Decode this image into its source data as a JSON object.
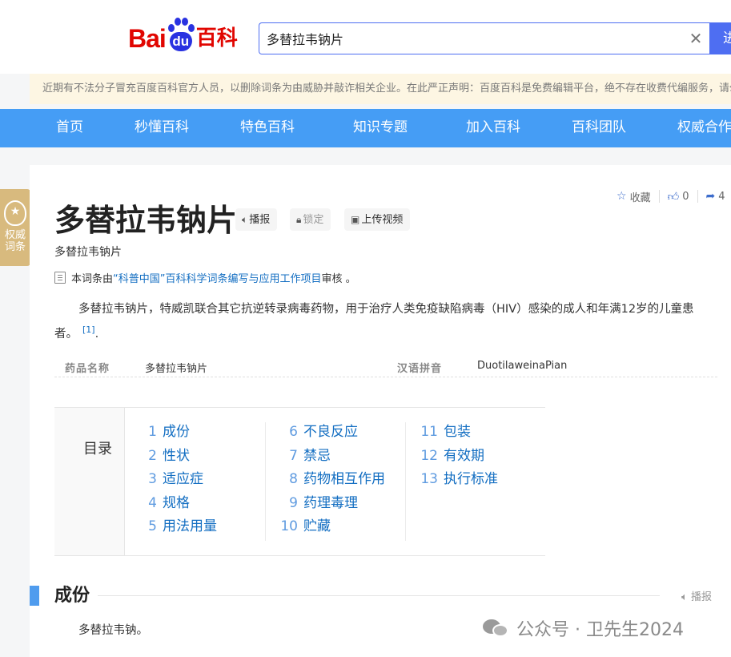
{
  "header": {
    "logo_bai": "Bai",
    "logo_du": "du",
    "logo_baike": "百科",
    "search_value": "多替拉韦钠片",
    "clear_glyph": "✕",
    "search_button": "进"
  },
  "notice": "近期有不法分子冒充百度百科官方人员，以删除词条为由威胁并敲诈相关企业。在此严正声明：百度百科是免费编辑平台，绝不存在收费代编服务，请勿上当受骗！",
  "nav": [
    "首页",
    "秒懂百科",
    "特色百科",
    "知识专题",
    "加入百科",
    "百科团队",
    "权威合作"
  ],
  "side_badge": {
    "line1": "权威",
    "line2": "词条"
  },
  "top_actions": {
    "collect": "收藏",
    "like_count": "0",
    "share_count": "4"
  },
  "title": "多替拉韦钠片",
  "title_buttons": {
    "play": "播报",
    "lock": "锁定",
    "upload_video": "上传视频"
  },
  "subtitle": "多替拉韦钠片",
  "review": {
    "prefix": "本词条由",
    "link": "“科普中国”百科科学词条编写与应用工作项目",
    "suffix": " 审核 。"
  },
  "summary": {
    "text": "多替拉韦钠片，特威凯联合其它抗逆转录病毒药物，用于治疗人类免疫缺陷病毒（HIV）感染的成人和年满12岁的儿童患者。",
    "ref": "[1]"
  },
  "infobox": [
    {
      "key": "药品名称",
      "value": "多替拉韦钠片"
    },
    {
      "key": "汉语拼音",
      "value": "DuotilaweinaPian"
    }
  ],
  "catalog": {
    "title": "目录",
    "columns": [
      [
        {
          "num": "1",
          "label": "成份"
        },
        {
          "num": "2",
          "label": "性状"
        },
        {
          "num": "3",
          "label": "适应症"
        },
        {
          "num": "4",
          "label": "规格"
        },
        {
          "num": "5",
          "label": "用法用量"
        }
      ],
      [
        {
          "num": "6",
          "label": "不良反应"
        },
        {
          "num": "7",
          "label": "禁忌"
        },
        {
          "num": "8",
          "label": "药物相互作用"
        },
        {
          "num": "9",
          "label": "药理毒理"
        },
        {
          "num": "10",
          "label": "贮藏"
        }
      ],
      [
        {
          "num": "11",
          "label": "包装"
        },
        {
          "num": "12",
          "label": "有效期"
        },
        {
          "num": "13",
          "label": "执行标准"
        }
      ]
    ]
  },
  "section": {
    "title": "成份",
    "play": "播报",
    "body": "多替拉韦钠。"
  },
  "watermark": "公众号 · 卫先生2024"
}
